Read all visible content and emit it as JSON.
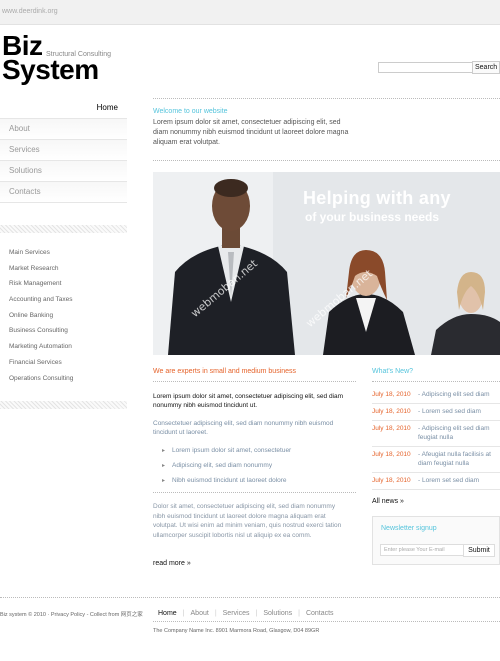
{
  "browser": {
    "url_text": "www.deerdink.org"
  },
  "header": {
    "logo_line1": "Biz",
    "logo_line2": "System",
    "tagline": "Structural Consulting",
    "search_button": "Search"
  },
  "nav": {
    "items": [
      "Home",
      "About",
      "Services",
      "Solutions",
      "Contacts"
    ]
  },
  "services": [
    "Main Services",
    "Market Research",
    "Risk Management",
    "Accounting and Taxes",
    "Online Banking",
    "Business Consulting",
    "Marketing Automation",
    "Financial Services",
    "Operations Consulting"
  ],
  "welcome": {
    "title": "Welcome to our website",
    "text": "Lorem ipsum dolor sit amet, consectetuer adipiscing elit, sed diam nonummy nibh euismod tincidunt ut laoreet dolore magna aliquam erat volutpat."
  },
  "hero": {
    "line1": "Helping with any",
    "line2": "of your business needs",
    "watermark": "webmoban.net"
  },
  "content": {
    "title": "We are experts in small and medium business",
    "intro": "Lorem ipsum dolor sit amet, consectetuer adipiscing elit, sed diam nonummy nibh euismod tincidunt ut.",
    "intro2": "Consectetuer adipiscing elit, sed diam nonummy nibh euismod tincidunt ut laoreet.",
    "bullets": [
      "Lorem ipsum dolor sit amet, consectetuer",
      "Adipiscing elit, sed diam nonummy",
      "Nibh euismod tincidunt ut laoreet dolore"
    ],
    "para": "Dolor sit amet, consectetuer adipiscing elit, sed diam nonummy nibh euismod tincidunt ut laoreet dolore magna aliquam erat volutpat. Ut wisi enim ad minim veniam, quis nostrud exerci tation ullamcorper suscipit lobortis nisl ut aliquip ex ea comm.",
    "read_more": "read more »"
  },
  "news": {
    "title": "What's New?",
    "items": [
      {
        "date": "July 18, 2010",
        "text": "- Adipiscing elit sed diam"
      },
      {
        "date": "July 18, 2010",
        "text": "- Lorem sed sed diam"
      },
      {
        "date": "July 18, 2010",
        "text": "- Adipiscing elit sed diam feugiat nulla"
      },
      {
        "date": "July 18, 2010",
        "text": "- Afeugiat nulla facilisis at diam feugiat nulla"
      },
      {
        "date": "July 18, 2010",
        "text": "- Lorem set sed diam"
      }
    ],
    "all_news": "All news »"
  },
  "newsletter": {
    "title": "Newsletter signup",
    "placeholder": "Enter please Your E-mail",
    "button": "Submit"
  },
  "footer": {
    "copyright": "Biz system © 2010  ·  Privacy Policy - Collect from 网页之家",
    "nav": [
      "Home",
      "About",
      "Services",
      "Solutions",
      "Contacts"
    ],
    "address": "The Company Name Inc. 8901 Marmora Road, Glasgow, D04 89GR"
  },
  "colors": {
    "accent_blue": "#55c4dc",
    "accent_orange": "#e5632b"
  }
}
